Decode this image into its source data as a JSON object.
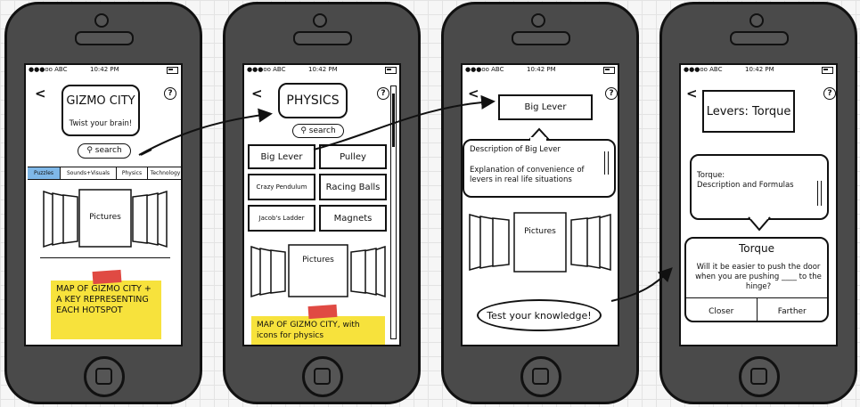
{
  "status": {
    "carrier": "●●●oo ABC",
    "time": "10:42 PM"
  },
  "screen1": {
    "title": "GIZMO CITY",
    "tagline": "Twist your brain!",
    "search": "search",
    "tabs": [
      "Puzzles",
      "Sounds+Visuals",
      "Physics",
      "Technology"
    ],
    "pictures": "Pictures",
    "note": "MAP OF GIZMO CITY + A KEY REPRESENTING EACH HOTSPOT"
  },
  "screen2": {
    "title": "PHYSICS",
    "search": "search",
    "buttons": [
      "Big Lever",
      "Pulley",
      "Crazy Pendulum",
      "Racing Balls",
      "Jacob's Ladder",
      "Magnets"
    ],
    "pictures": "Pictures",
    "note": "MAP OF GIZMO CITY, with icons for physics"
  },
  "screen3": {
    "title": "Big Lever",
    "description": "Description of Big Lever",
    "explanation": "Explanation of convenience of levers in real life situations",
    "pictures": "Pictures",
    "cta": "Test your knowledge!"
  },
  "screen4": {
    "title": "Levers: Torque",
    "torque_text": "Torque:\nDescription and Formulas",
    "quiz_title": "Torque",
    "question": "Will it be easier to push the door when you are pushing ____ to the hinge?",
    "answers": [
      "Closer",
      "Farther"
    ]
  },
  "colors": {
    "phone": "#4a4a4a",
    "note": "#f7e23c",
    "tape": "#e04a43",
    "active_tab": "#7fb8e8"
  }
}
